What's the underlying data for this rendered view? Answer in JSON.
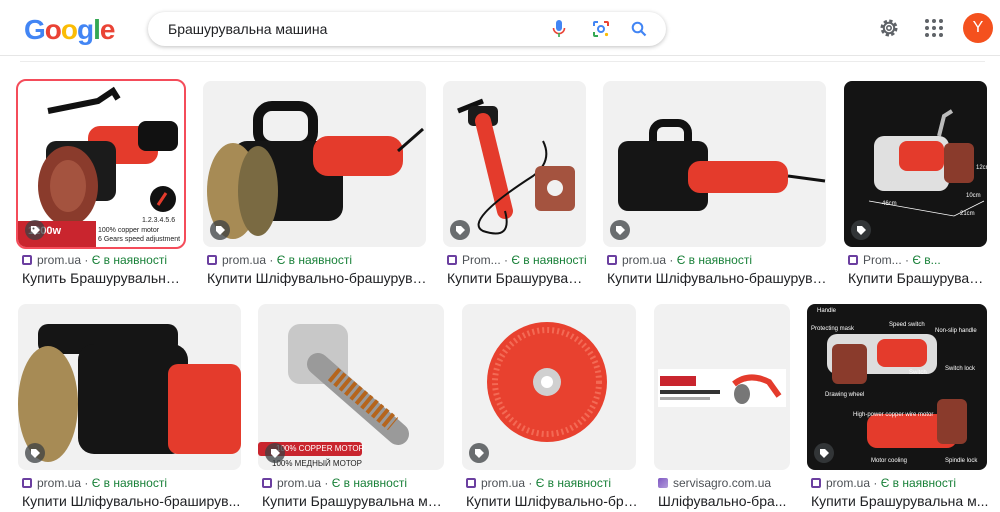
{
  "header": {
    "search_query": "Брашурувальна машина",
    "avatar_letter": "Y"
  },
  "results": [
    {
      "source": "prom.ua",
      "stock": "Є в наявності",
      "title": "Купить Брашурувальна ...",
      "overlay": [
        "1200w",
        "100% copper motor",
        "6 Gears speed adjustment",
        "1.2.3.4.5.6"
      ]
    },
    {
      "source": "prom.ua",
      "stock": "Є в наявності",
      "title": "Купити Шліфувально-брашурува..."
    },
    {
      "source": "Prom...",
      "stock": "Є в наявності",
      "title": "Купити Брашурувал..."
    },
    {
      "source": "prom.ua",
      "stock": "Є в наявності",
      "title": "Купити Шліфувально-брашурува..."
    },
    {
      "source": "Prom...",
      "stock": "Є в...",
      "title": "Купити Брашуруваль...",
      "dims": [
        "46cm",
        "21cm",
        "10cm",
        "12cm"
      ]
    },
    {
      "source": "prom.ua",
      "stock": "Є в наявності",
      "title": "Купити Шліфувально-браширув..."
    },
    {
      "source": "prom.ua",
      "stock": "Є в наявності",
      "title": "Купити Брашурувальна ма...",
      "overlay": [
        "100% COPPER MOTOR",
        "100% МЕДНЫЙ МОТОР"
      ]
    },
    {
      "source": "prom.ua",
      "stock": "Є в наявності",
      "title": "Купити Шліфувально-бра..."
    },
    {
      "source": "servisagro.com.ua",
      "stock": "",
      "title": "Шліфувально-бра..."
    },
    {
      "source": "prom.ua",
      "stock": "Є в наявності",
      "title": "Купити Брашурувальна м...",
      "labels": [
        "Handle",
        "Speed switch",
        "Protecting mask",
        "Non-slip handle",
        "Switch",
        "Switch lock",
        "Drawing wheel",
        "High-power copper wire motor",
        "Motor cooling",
        "Spindle lock"
      ]
    }
  ]
}
